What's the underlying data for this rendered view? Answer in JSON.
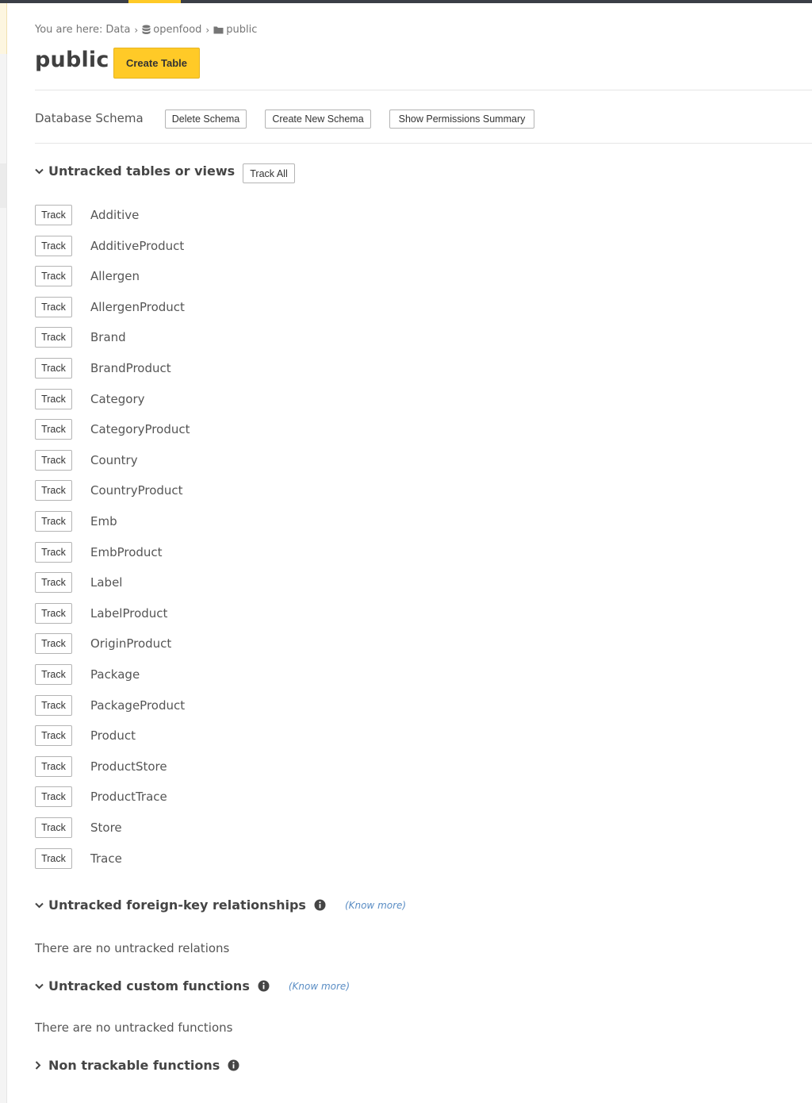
{
  "breadcrumb": {
    "prefix": "You are here:",
    "data_label": "Data",
    "database": "openfood",
    "schema": "public"
  },
  "page": {
    "title": "public",
    "create_table_label": "Create Table"
  },
  "schema_bar": {
    "label": "Database Schema",
    "delete_label": "Delete Schema",
    "create_new_label": "Create New Schema",
    "permissions_label": "Show Permissions Summary"
  },
  "untracked_tables": {
    "title": "Untracked tables or views",
    "track_all_label": "Track All",
    "track_label": "Track",
    "items": [
      "Additive",
      "AdditiveProduct",
      "Allergen",
      "AllergenProduct",
      "Brand",
      "BrandProduct",
      "Category",
      "CategoryProduct",
      "Country",
      "CountryProduct",
      "Emb",
      "EmbProduct",
      "Label",
      "LabelProduct",
      "OriginProduct",
      "Package",
      "PackageProduct",
      "Product",
      "ProductStore",
      "ProductTrace",
      "Store",
      "Trace"
    ]
  },
  "untracked_relations": {
    "title": "Untracked foreign-key relationships",
    "know_more": "(Know more)",
    "empty": "There are no untracked relations"
  },
  "untracked_functions": {
    "title": "Untracked custom functions",
    "know_more": "(Know more)",
    "empty": "There are no untracked functions"
  },
  "non_trackable": {
    "title": "Non trackable functions"
  },
  "icons": {
    "database": "database-icon",
    "folder": "folder-icon",
    "info": "info-icon",
    "chevron_down": "chevron-down-icon",
    "chevron_right": "chevron-right-icon"
  },
  "colors": {
    "accent": "#ffca27",
    "topbar": "#3b3f47",
    "link": "#5a8dc4"
  }
}
